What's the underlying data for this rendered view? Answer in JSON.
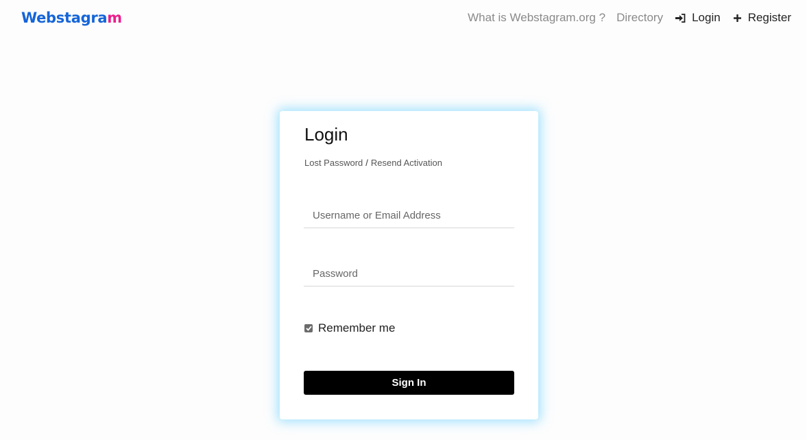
{
  "brand": {
    "logo_main": "Webstagra",
    "logo_end": "m",
    "logo_color": "#1565d8",
    "logo_end_color": "#ec1f8c"
  },
  "nav": {
    "what_is": "What is Webstagram.org ?",
    "directory": "Directory",
    "login": "Login",
    "login_icon": "sign-in-icon",
    "register": "Register",
    "register_icon": "plus-icon"
  },
  "login_card": {
    "title": "Login",
    "lost_password": "Lost Password",
    "separator": "/",
    "resend_activation": "Resend Activation",
    "username_placeholder": "Username or Email Address",
    "username_value": "",
    "password_placeholder": "Password",
    "password_value": "",
    "remember_label": "Remember me",
    "remember_checked": true,
    "signin_label": "Sign In",
    "glow_color": "#5ccdff",
    "button_color": "#000000"
  }
}
